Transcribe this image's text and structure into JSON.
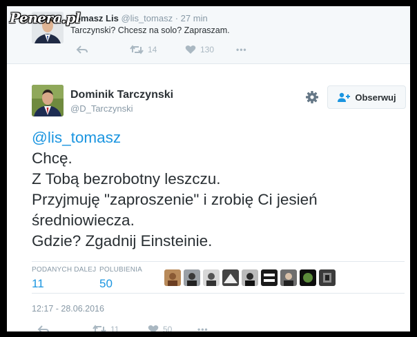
{
  "watermark": "Penera.pl",
  "reply_context": {
    "author_name": "Tomasz Lis",
    "handle": "@lis_tomasz",
    "time": "27 min",
    "text": "Tarczynski? Chcesz na solo? Zapraszam.",
    "retweets": "14",
    "likes": "130",
    "more": "•••"
  },
  "tweet": {
    "author_name": "Dominik Tarczynski",
    "handle": "@D_Tarczynski",
    "follow_label": "Obserwuj",
    "mention": "@lis_tomasz",
    "lines": [
      "Chcę.",
      "Z Tobą bezrobotny leszczu.",
      "Przyjmuję \"zaproszenie\" i zrobię Ci jesień",
      "średniowiecza.",
      "Gdzie? Zgadnij Einsteinie."
    ],
    "stats": {
      "retweets_label": "PODANYCH DALEJ",
      "retweets_value": "11",
      "likes_label": "POLUBIENIA",
      "likes_value": "50"
    },
    "timestamp": "12:17 - 28.06.2016",
    "action_retweets": "11",
    "action_likes": "50"
  },
  "colors": {
    "link": "#1b95e0",
    "text": "#292f33",
    "muted": "#8899a6",
    "action": "#aab8c2",
    "border": "#e1e8ed"
  },
  "likers": [
    "avatar-1",
    "avatar-2",
    "avatar-3",
    "avatar-4",
    "avatar-5",
    "avatar-6",
    "avatar-7",
    "avatar-8",
    "avatar-9"
  ]
}
